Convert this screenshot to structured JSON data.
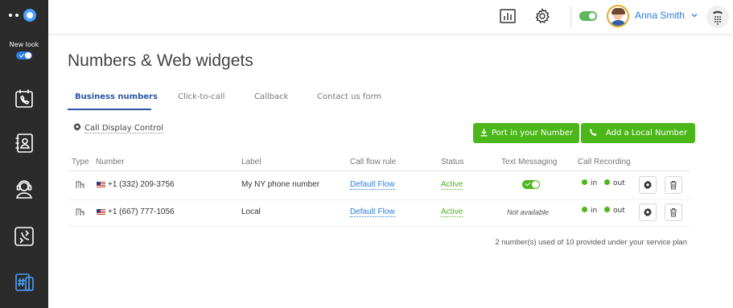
{
  "sidebar": {
    "new_look_label": "New look",
    "new_look_enabled": true,
    "items": [
      {
        "icon": "phone-calendar-icon"
      },
      {
        "icon": "contacts-icon"
      },
      {
        "icon": "agent-headset-icon"
      },
      {
        "icon": "call-flow-icon"
      },
      {
        "icon": "numbers-hash-icon",
        "active": true
      }
    ]
  },
  "topbar": {
    "icons": [
      "reports-chart-icon",
      "settings-gear-icon"
    ],
    "status_toggle_on": true,
    "user_name": "Anna Smith"
  },
  "page": {
    "title": "Numbers & Web widgets",
    "tabs": [
      {
        "label": "Business numbers",
        "active": true
      },
      {
        "label": "Click-to-call",
        "active": false
      },
      {
        "label": "Callback",
        "active": false
      },
      {
        "label": "Contact us form",
        "active": false
      }
    ],
    "call_display_control": "Call Display Control",
    "buttons": {
      "port_number": "Port in your Number",
      "add_local": "Add a Local Number"
    }
  },
  "table": {
    "columns": [
      "Type",
      "Number",
      "Label",
      "Call flow rule",
      "Status",
      "Text Messaging",
      "Call Recording"
    ],
    "rows": [
      {
        "type_icon": "building-icon",
        "flag": "us-flag",
        "number": "+1 (332) 209-3756",
        "label": "My NY phone number",
        "call_flow_rule": "Default Flow",
        "status": "Active",
        "text_messaging": "on",
        "text_messaging_label": "",
        "rec_in": "in",
        "rec_out": "out"
      },
      {
        "type_icon": "building-icon",
        "flag": "us-flag",
        "number": "+1 (667) 777-1056",
        "label": "Local",
        "call_flow_rule": "Default Flow",
        "status": "Active",
        "text_messaging": "unavailable",
        "text_messaging_label": "Not available",
        "rec_in": "in",
        "rec_out": "out"
      }
    ]
  },
  "usage_note": "2 number(s) used of 10 provided under your service plan",
  "colors": {
    "sidebar_bg": "#2b2b2b",
    "accent_blue": "#2c7be5",
    "tab_active": "#2b55a8",
    "green": "#4cb71a"
  }
}
